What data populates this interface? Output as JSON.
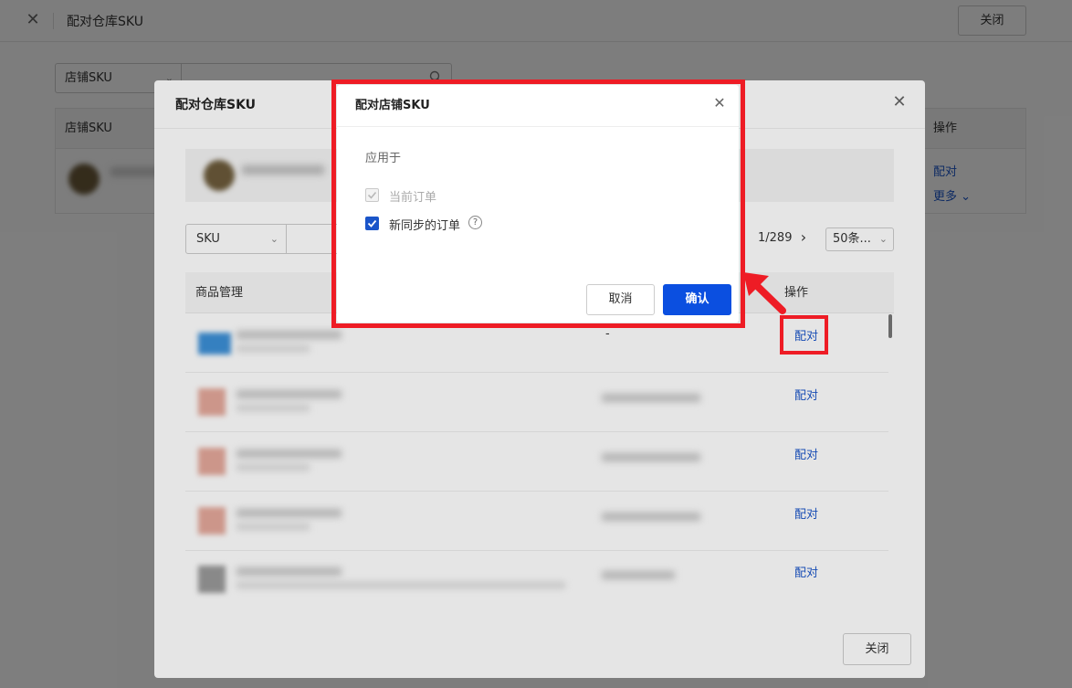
{
  "page": {
    "title": "配对仓库SKU",
    "close_label": "关闭"
  },
  "base": {
    "filter_select": "店铺SKU",
    "table_header_first": "店铺SKU",
    "table_header_op": "操作",
    "row_link_pair": "配对",
    "row_link_more": "更多"
  },
  "mid_modal": {
    "title": "配对仓库SKU",
    "filter_select": "SKU",
    "pager_text": "1/289",
    "page_size": "50条...",
    "col_product": "商品管理",
    "col_op": "操作",
    "rows": [
      {
        "value": "-",
        "action": "配对"
      },
      {
        "value": "",
        "action": "配对"
      },
      {
        "value": "",
        "action": "配对"
      },
      {
        "value": "",
        "action": "配对"
      },
      {
        "value": "",
        "action": "配对"
      }
    ],
    "close_label": "关闭"
  },
  "dialog": {
    "title": "配对店铺SKU",
    "applies_to": "应用于",
    "option_current": {
      "label": "当前订单",
      "checked": true,
      "disabled": true
    },
    "option_new": {
      "label": "新同步的订单",
      "checked": true,
      "disabled": false
    },
    "cancel_label": "取消",
    "confirm_label": "确认"
  },
  "colors": {
    "primary": "#0b4fe0",
    "link": "#1a55c9",
    "annotation": "#ee1c25"
  }
}
